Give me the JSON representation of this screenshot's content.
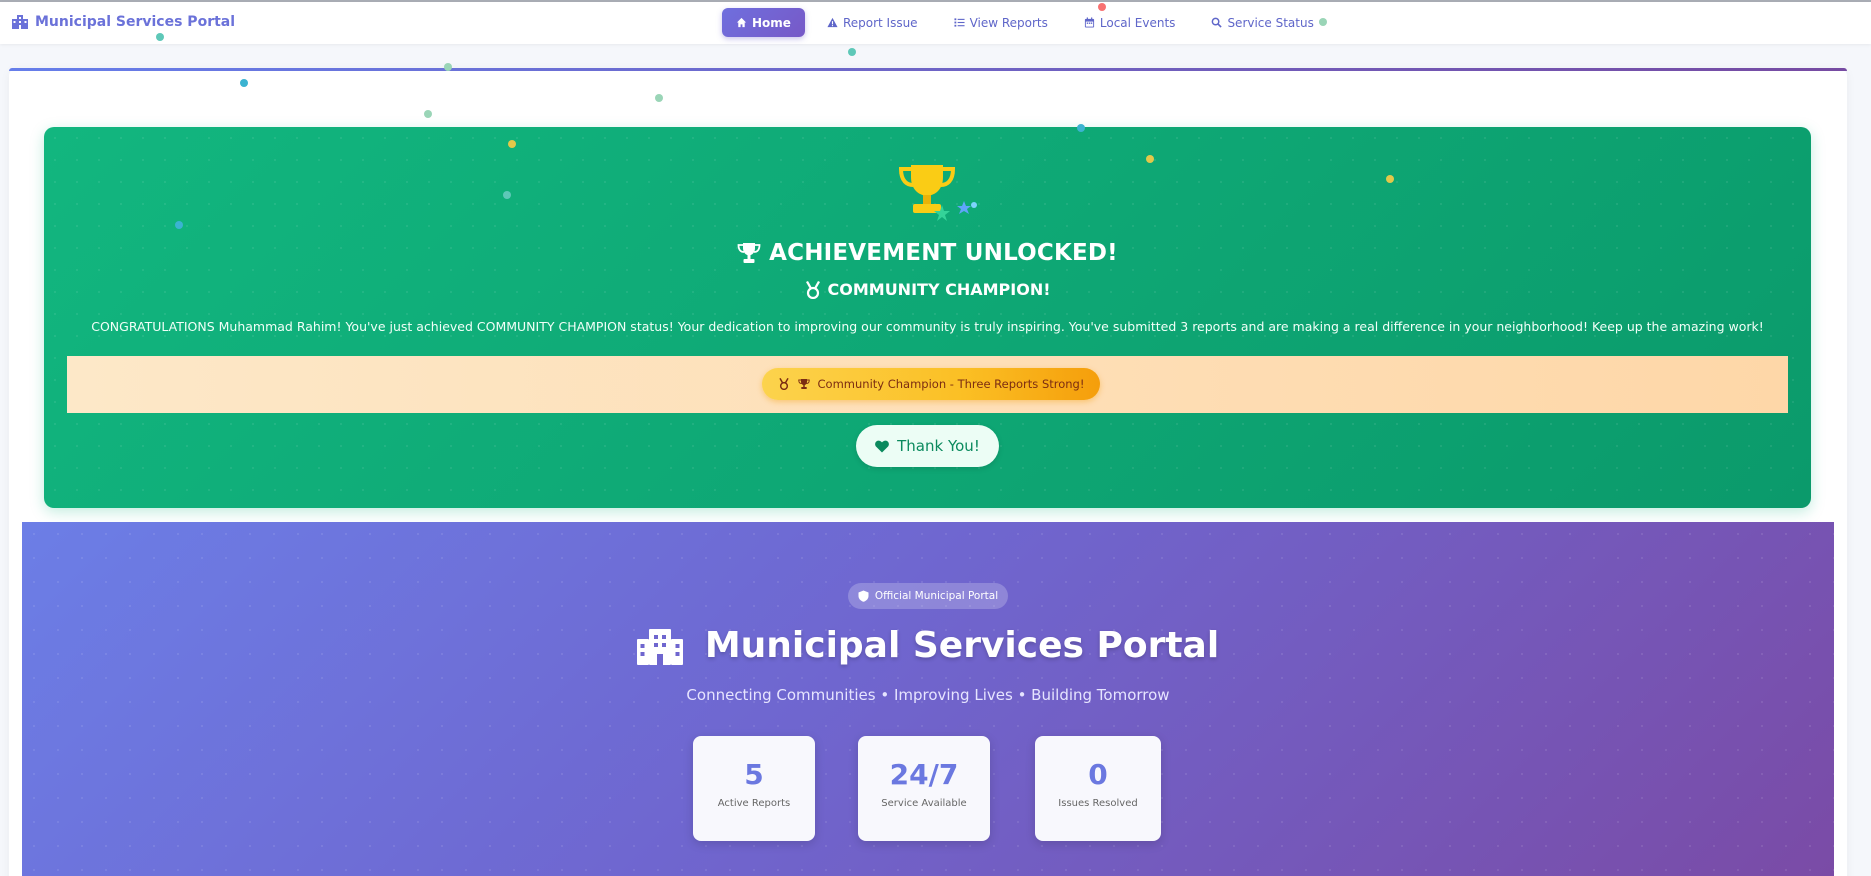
{
  "nav": {
    "brand": "Municipal Services Portal",
    "items": [
      {
        "label": "Home",
        "icon": "home-icon",
        "active": true
      },
      {
        "label": "Report Issue",
        "icon": "warning-icon"
      },
      {
        "label": "View Reports",
        "icon": "list-icon"
      },
      {
        "label": "Local Events",
        "icon": "calendar-icon"
      },
      {
        "label": "Service Status",
        "icon": "search-icon"
      }
    ]
  },
  "achievement": {
    "title": "ACHIEVEMENT UNLOCKED!",
    "subtitle": "COMMUNITY CHAMPION!",
    "message": "CONGRATULATIONS Muhammad Rahim! You've just achieved COMMUNITY CHAMPION status! Your dedication to improving our community is truly inspiring. You've submitted 3 reports and are making a real difference in your neighborhood! Keep up the amazing work!",
    "badge": "Community Champion - Three Reports Strong!",
    "button": "Thank You!"
  },
  "hero": {
    "badge": "Official Municipal Portal",
    "title": "Municipal Services Portal",
    "tagline": "Connecting Communities • Improving Lives • Building Tomorrow",
    "stats": [
      {
        "value": "5",
        "label": "Active Reports"
      },
      {
        "value": "24/7",
        "label": "Service Available"
      },
      {
        "value": "0",
        "label": "Issues Resolved"
      }
    ]
  },
  "colors": {
    "primary": "#667eea",
    "secondary": "#764ba2",
    "success": "#10b981",
    "gold": "#fbbf24"
  }
}
